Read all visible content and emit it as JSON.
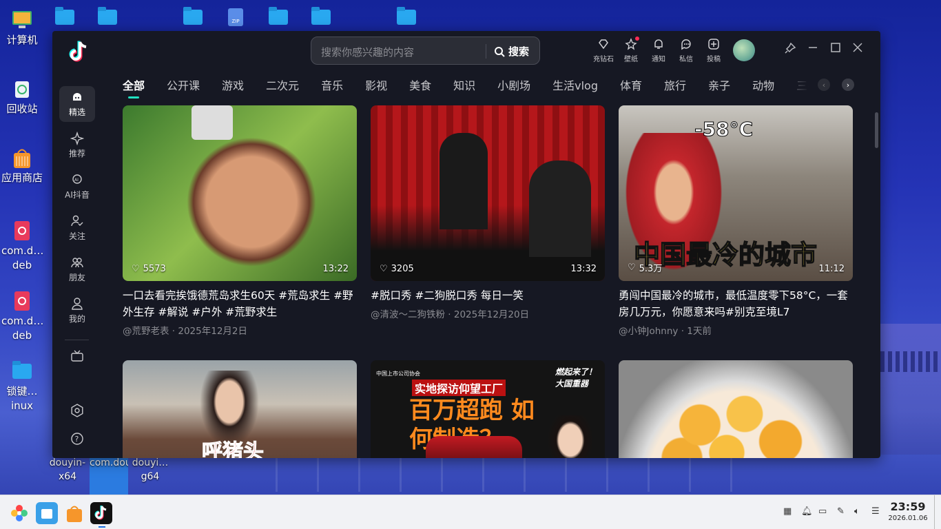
{
  "desktop": {
    "icons": [
      {
        "label": "计算机"
      },
      {
        "label": "回收站"
      },
      {
        "label": "应用商店"
      },
      {
        "label": "com.d…deb"
      },
      {
        "label": "com.d…deb"
      },
      {
        "label": "锁键…inux"
      }
    ],
    "bottom_labels": [
      {
        "label": "douyin-x64"
      },
      {
        "label": "com.douyin.deepi"
      },
      {
        "label": "douyi…g64"
      }
    ],
    "zip_label": "ZIP"
  },
  "app": {
    "search": {
      "placeholder": "搜索你感兴趣的内容",
      "button": "搜索"
    },
    "toolbar": [
      {
        "label": "充钻石",
        "icon": "diamond-icon"
      },
      {
        "label": "壁纸",
        "icon": "wallpaper-icon"
      },
      {
        "label": "通知",
        "icon": "bell-icon"
      },
      {
        "label": "私信",
        "icon": "message-icon"
      },
      {
        "label": "投稿",
        "icon": "upload-icon"
      }
    ],
    "tabs": [
      "全部",
      "公开课",
      "游戏",
      "二次元",
      "音乐",
      "影视",
      "美食",
      "知识",
      "小剧场",
      "生活vlog",
      "体育",
      "旅行",
      "亲子",
      "动物",
      "三农"
    ],
    "sidebar": [
      {
        "label": "精选",
        "icon": "featured-icon"
      },
      {
        "label": "推荐",
        "icon": "recommend-icon"
      },
      {
        "label": "AI抖音",
        "icon": "ai-icon"
      },
      {
        "label": "关注",
        "icon": "follow-icon"
      },
      {
        "label": "朋友",
        "icon": "friends-icon"
      },
      {
        "label": "我的",
        "icon": "profile-icon"
      }
    ],
    "videos": [
      {
        "title": "一口去看完挨饿德荒岛求生60天 #荒岛求生 #野外生存 #解说 #户外 #荒野求生",
        "likes": "5573",
        "duration": "13:22",
        "author": "@荒野老表",
        "date": "2025年12月2日"
      },
      {
        "title": "#脱口秀 #二狗脱口秀 每日一笑",
        "likes": "3205",
        "duration": "13:32",
        "author": "@清波～二狗铁粉",
        "date": "2025年12月20日"
      },
      {
        "title": "勇闯中国最冷的城市，最低温度零下58°C，一套房几万元，你愿意来吗#别克至境L7",
        "likes": "5.3万",
        "duration": "11:12",
        "author": "@小钟Johnny",
        "date": "1天前",
        "overlay_top": "-58°C",
        "overlay_bottom": "中国最冷的城市"
      },
      {
        "title": "",
        "overlay_bottom": "呼猪头"
      },
      {
        "title": "",
        "overlay_top": "实地探访仰望工厂",
        "overlay_main": "百万超跑 如何制造？",
        "overlay_corner": "燃起来了！大国重器",
        "overlay_small": "中国上市公司协会"
      },
      {
        "title": ""
      }
    ]
  },
  "taskbar": {
    "time": "23:59",
    "date": "2026.01.06"
  },
  "colors": {
    "accent": "#20e0c0",
    "brand_red": "#fe2c55",
    "window_bg": "#161823"
  }
}
